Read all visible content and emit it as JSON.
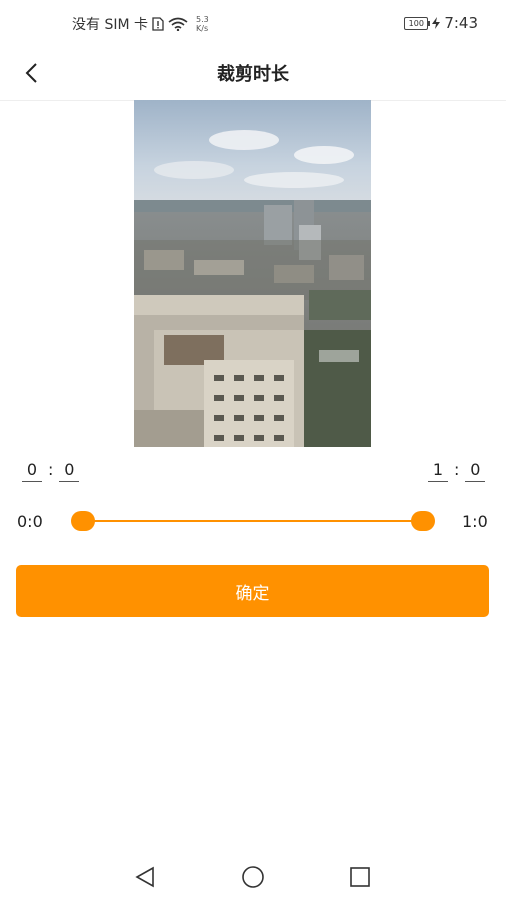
{
  "status_bar": {
    "carrier": "没有 SIM 卡",
    "speed_value": "5.3",
    "speed_unit": "K/s",
    "battery": "100",
    "time": "7:43"
  },
  "header": {
    "title": "裁剪时长",
    "back_icon": "chevron-left-icon"
  },
  "preview": {
    "description_icon": "video-thumbnail"
  },
  "start_time": {
    "min": "0",
    "sec": "0"
  },
  "end_time": {
    "min": "1",
    "sec": "0"
  },
  "range_slider": {
    "start_label": "0:0",
    "end_label": "1:0",
    "start_fraction": 0,
    "end_fraction": 1
  },
  "confirm_button": {
    "label": "确定"
  },
  "colors": {
    "accent": "#ff9100"
  },
  "nav": {
    "back_icon": "triangle-back-icon",
    "home_icon": "circle-home-icon",
    "recents_icon": "square-recents-icon"
  }
}
